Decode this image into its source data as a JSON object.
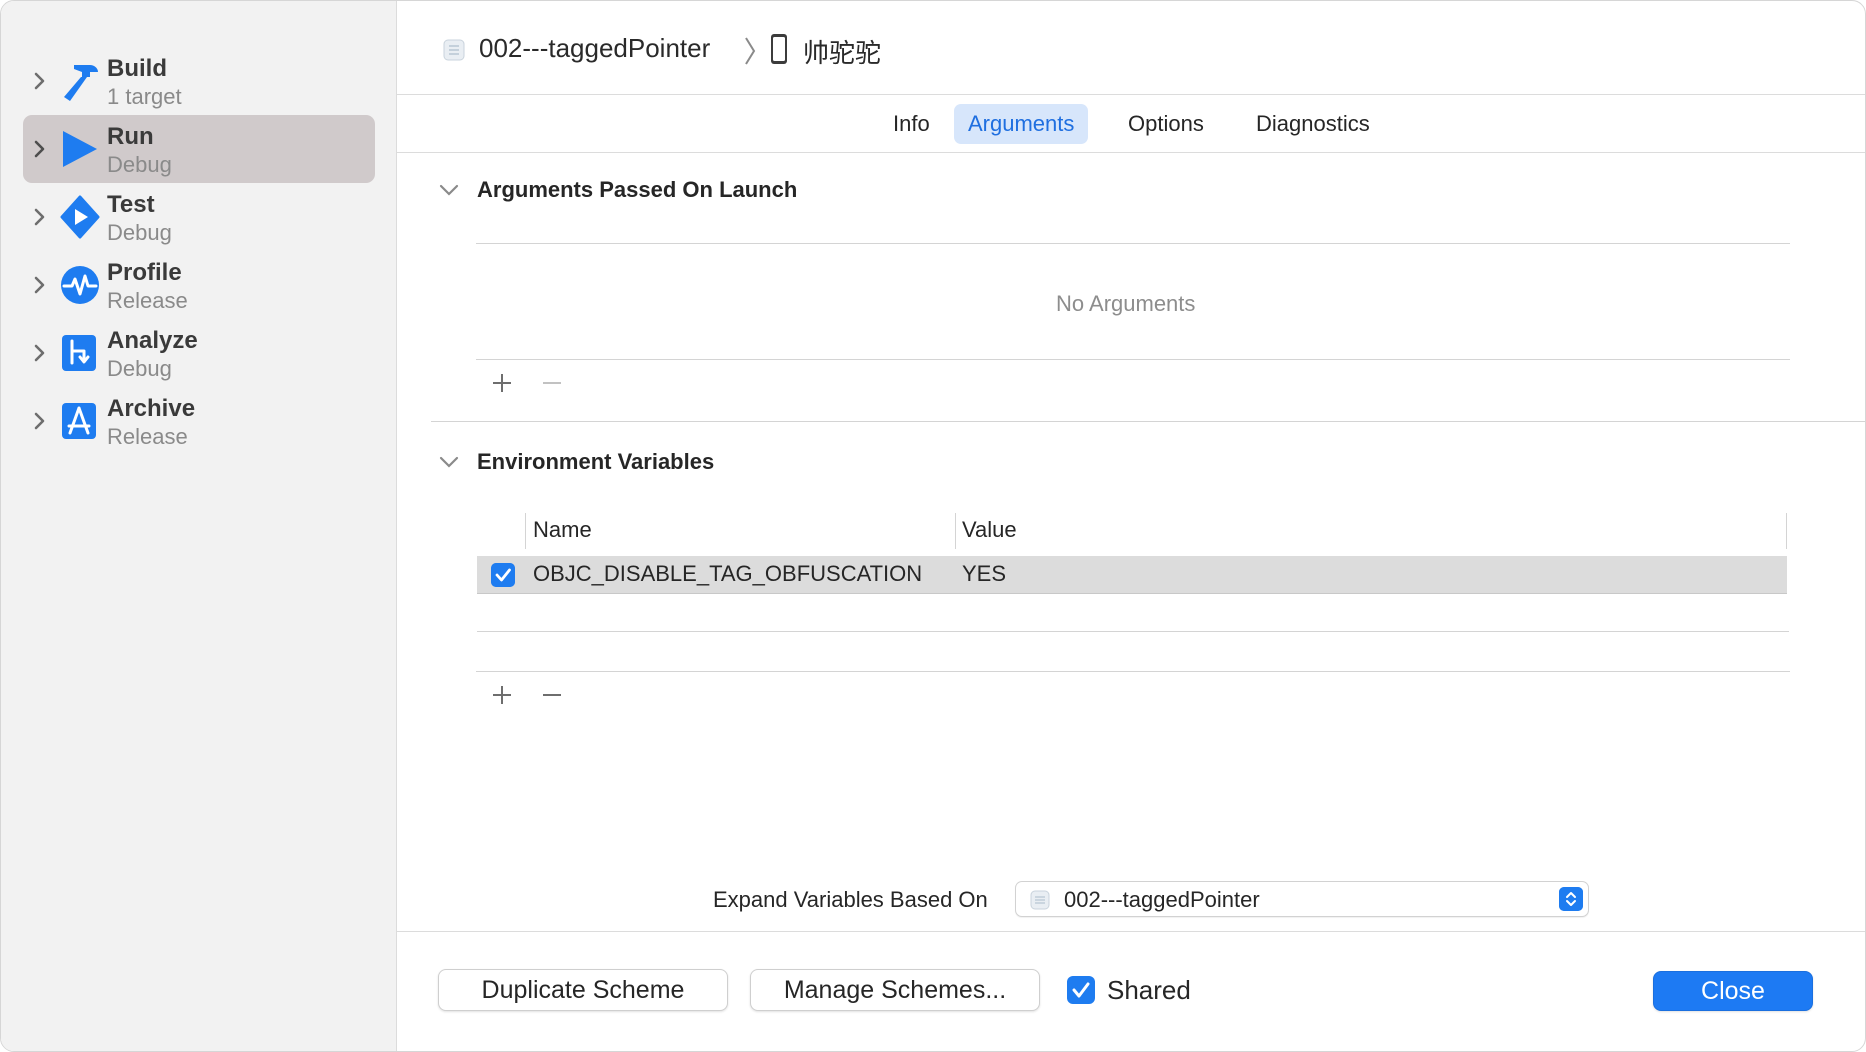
{
  "sidebar": {
    "actions": [
      {
        "name": "Build",
        "sub": "1 target",
        "icon": "hammer-icon"
      },
      {
        "name": "Run",
        "sub": "Debug",
        "icon": "play-icon",
        "selected": true
      },
      {
        "name": "Test",
        "sub": "Debug",
        "icon": "test-diamond-icon"
      },
      {
        "name": "Profile",
        "sub": "Release",
        "icon": "waveform-icon"
      },
      {
        "name": "Analyze",
        "sub": "Debug",
        "icon": "analyze-icon"
      },
      {
        "name": "Archive",
        "sub": "Release",
        "icon": "archive-appstore-icon"
      }
    ]
  },
  "header": {
    "target": "002---taggedPointer",
    "device": "帅驼驼"
  },
  "tabs": [
    {
      "label": "Info"
    },
    {
      "label": "Arguments",
      "active": true
    },
    {
      "label": "Options"
    },
    {
      "label": "Diagnostics"
    }
  ],
  "arguments_section": {
    "title": "Arguments Passed On Launch",
    "empty_text": "No Arguments"
  },
  "env_section": {
    "title": "Environment Variables",
    "columns": {
      "name": "Name",
      "value": "Value"
    },
    "rows": [
      {
        "enabled": true,
        "name": "OBJC_DISABLE_TAG_OBFUSCATION",
        "value": "YES"
      }
    ]
  },
  "expand": {
    "label": "Expand Variables Based On",
    "selected": "002---taggedPointer"
  },
  "footer": {
    "duplicate_label": "Duplicate Scheme",
    "manage_label": "Manage Schemes...",
    "shared_label": "Shared",
    "shared_checked": true,
    "close_label": "Close"
  },
  "colors": {
    "accent": "#1e7cf0",
    "selected_row": "#d0cacb",
    "tab_active_bg": "#d7e6fb"
  }
}
